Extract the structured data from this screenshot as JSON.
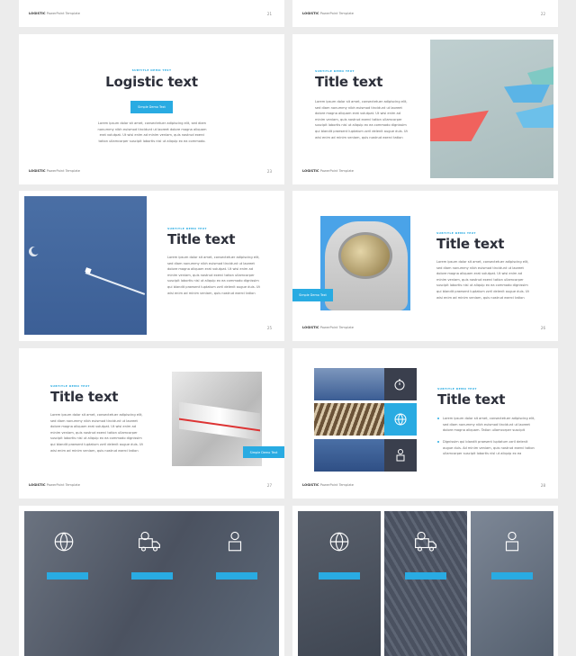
{
  "footer": {
    "brand": "LOGISTIC",
    "label": "PowerPoint Template"
  },
  "common": {
    "subtitle": "SUBTITLE DEMO TEXT",
    "button": "Simple Demo Text",
    "lorem_long": "Lorem ipsum dolor sit amet, consectetuer adipiscing elit, sed diam nonummy nibh euismod tincidunt ut laoreet dolore magna aliquam erat volutpat. Ut wisi enim ad minim veniam, quis nostrud exerci tation ullamcorper suscipit lobortis nisl ut aliquip ex ea commodo dignissim qui blandit praesent luptatum zzril delenit augue duis. Ut wisi enim ad minim veniam, quis nostrud exerci tation ullamcorper suscipit lobortis nisl ut aliquip ex ea commodo consequat. Duis autem vel",
    "lorem_short": "Lorem ipsum dolor sit amet, consectetuer adipiscing elit, sed diam nonummy nibh euismod tincidunt ut laoreet dolore magna aliquam erat volutpat. Ut wisi enim ad minim veniam, quis nostrud exerci tation ullamcorper suscipit lobortis nisl ut aliquip ex ea commodo.",
    "bullet1": "Lorem ipsum dolor sit amet, consectetuer adipiscing elit, sed diam nonummy nibh euismod tincidunt ut laoreet dolore magna aliquam. Tation ullamcorper suscipit lobortis nisl ut aliquip ex ea commodo.",
    "bullet2": "Dignissim qui blandit praesent luptatum zzril delenit augue duis. Ad minim veniam, quis nostrud exerci tation ullamcorper suscipit lobortis nisl ut aliquip ex ea commodo consequat. Duis autem vel"
  },
  "slides": [
    {
      "num": "21"
    },
    {
      "num": "22"
    },
    {
      "num": "23",
      "title": "Logistic text"
    },
    {
      "num": "24",
      "title": "Title text"
    },
    {
      "num": "25",
      "title": "Title text"
    },
    {
      "num": "26",
      "title": "Title text"
    },
    {
      "num": "27",
      "title": "Title text"
    },
    {
      "num": "28",
      "title": "Title text"
    }
  ],
  "colors": {
    "accent": "#29abe2",
    "dark": "#2c2f3a",
    "background": "#ececec"
  }
}
